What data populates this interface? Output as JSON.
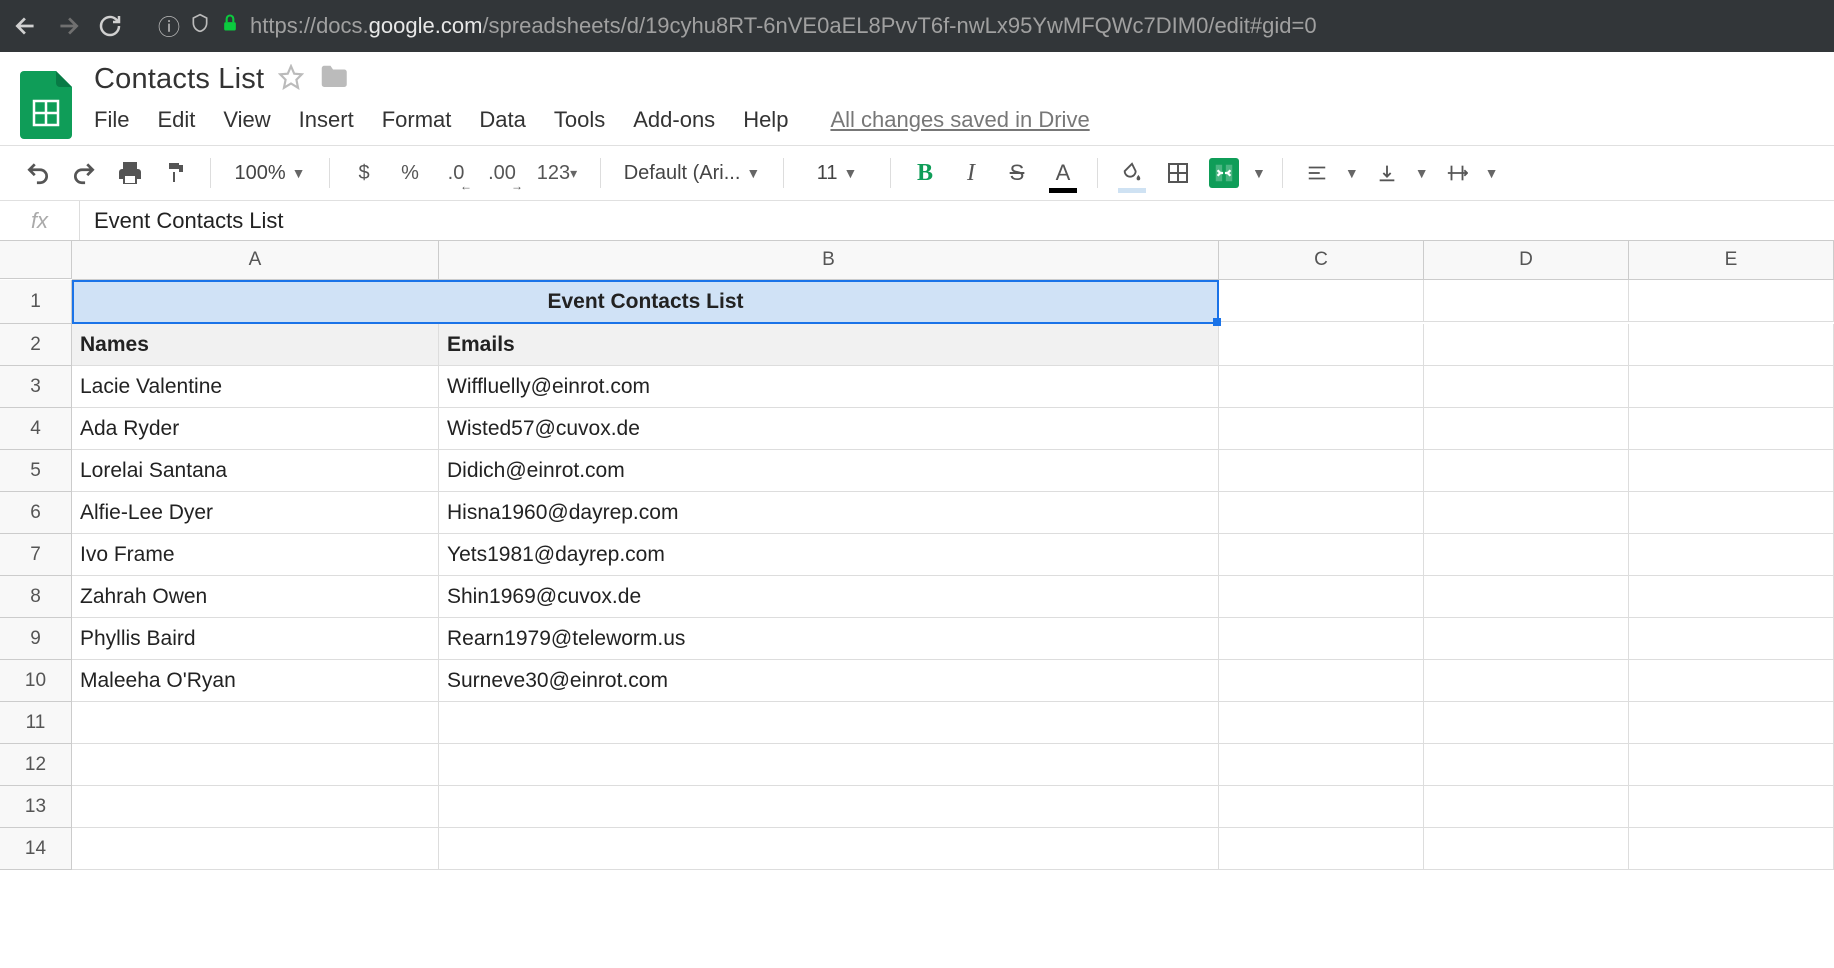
{
  "browser": {
    "url_prefix": "https://",
    "url_domain_light": "docs.",
    "url_domain_bold": "google.com",
    "url_path": "/spreadsheets/d/19cyhu8RT-6nVE0aEL8PvvT6f-nwLx95YwMFQWc7DIM0/edit#gid=0"
  },
  "doc": {
    "title": "Contacts List",
    "menus": [
      "File",
      "Edit",
      "View",
      "Insert",
      "Format",
      "Data",
      "Tools",
      "Add-ons",
      "Help"
    ],
    "saved_msg": "All changes saved in Drive"
  },
  "toolbar": {
    "zoom": "100%",
    "currency": "$",
    "percent": "%",
    "dec_dec": ".0",
    "inc_dec": ".00",
    "more_formats": "123",
    "font": "Default (Ari...",
    "font_size": "11"
  },
  "formula_bar": {
    "fx": "fx",
    "value": "Event Contacts List"
  },
  "grid": {
    "columns": [
      "A",
      "B",
      "C",
      "D",
      "E"
    ],
    "row_numbers": [
      "1",
      "2",
      "3",
      "4",
      "5",
      "6",
      "7",
      "8",
      "9",
      "10",
      "11",
      "12",
      "13",
      "14"
    ],
    "title_cell": "Event Contacts List",
    "headers": {
      "a": "Names",
      "b": "Emails"
    },
    "rows": [
      {
        "name": "Lacie Valentine",
        "email": "Wiffluelly@einrot.com"
      },
      {
        "name": "Ada Ryder",
        "email": "Wisted57@cuvox.de"
      },
      {
        "name": "Lorelai Santana",
        "email": "Didich@einrot.com"
      },
      {
        "name": "Alfie-Lee Dyer",
        "email": "Hisna1960@dayrep.com"
      },
      {
        "name": "Ivo Frame",
        "email": "Yets1981@dayrep.com"
      },
      {
        "name": "Zahrah Owen",
        "email": "Shin1969@cuvox.de"
      },
      {
        "name": "Phyllis Baird",
        "email": "Rearn1979@teleworm.us"
      },
      {
        "name": "Maleeha O'Ryan",
        "email": "Surneve30@einrot.com"
      }
    ]
  }
}
